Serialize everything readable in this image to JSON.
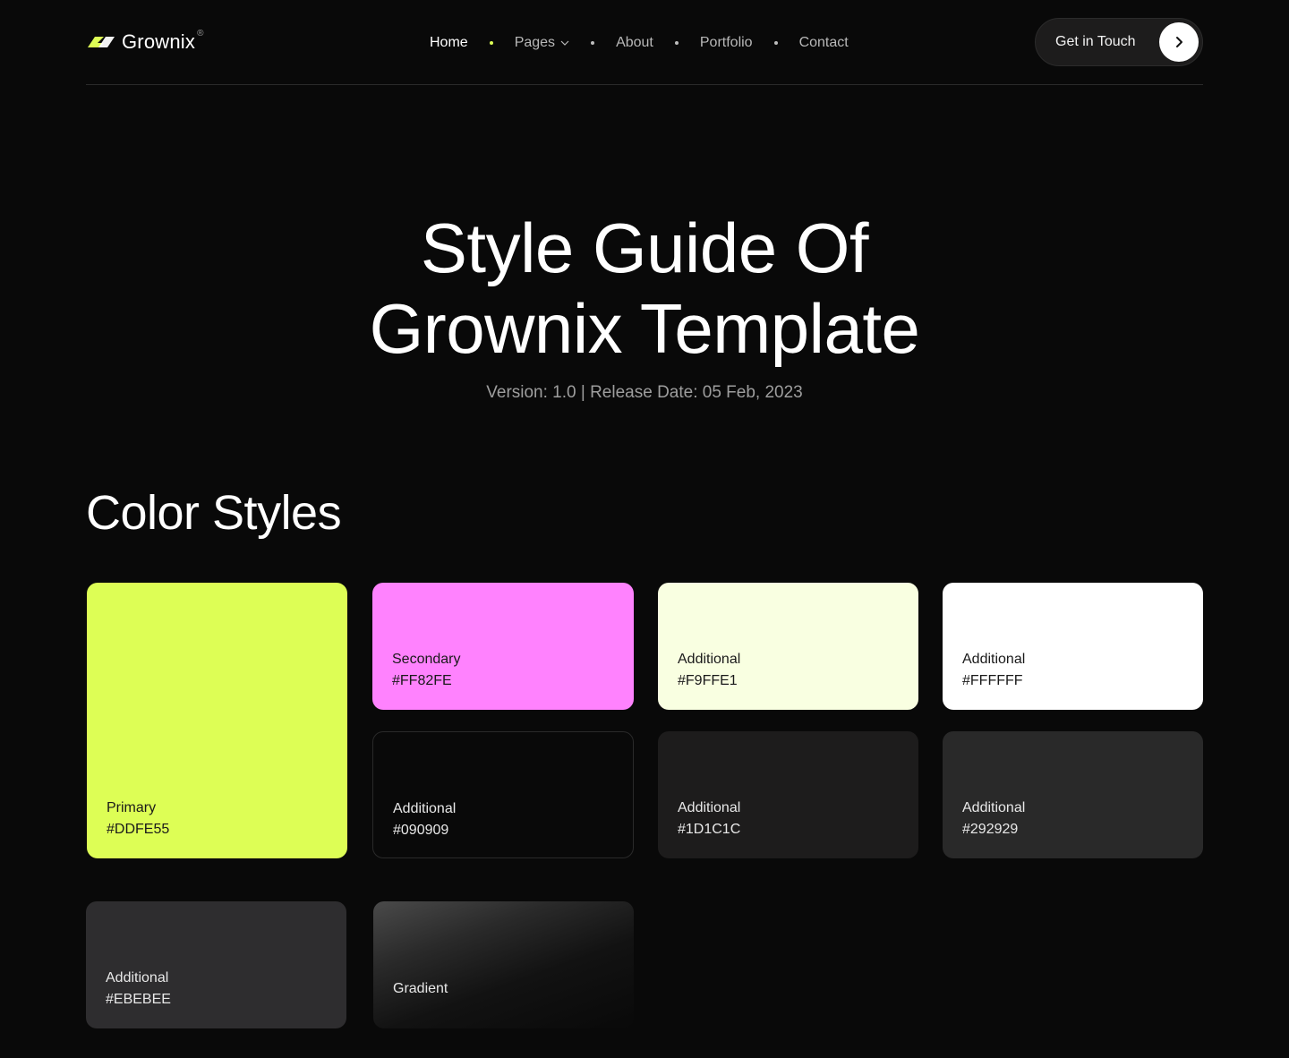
{
  "header": {
    "brand": "Grownix",
    "brand_mark": "®",
    "nav": [
      {
        "label": "Home"
      },
      {
        "label": "Pages"
      },
      {
        "label": "About"
      },
      {
        "label": "Portfolio"
      },
      {
        "label": "Contact"
      }
    ],
    "cta_label": "Get in Touch",
    "accent_color": "#DDFE55"
  },
  "hero": {
    "title_line1": "Style Guide Of",
    "title_line2": "Grownix Template",
    "subtitle": "Version: 1.0 | Release Date: 05 Feb, 2023"
  },
  "colors_section": {
    "title": "Color Styles",
    "swatches": [
      {
        "name": "Primary",
        "hex": "#DDFE55",
        "fill": "#DDFE55"
      },
      {
        "name": "Secondary",
        "hex": "#FF82FE",
        "fill": "#FF82FE"
      },
      {
        "name": "Additional",
        "hex": "#F9FFE1",
        "fill": "#F9FFE1"
      },
      {
        "name": "Additional",
        "hex": "#FFFFFF",
        "fill": "#FFFFFF"
      },
      {
        "name": "Additional",
        "hex": "#090909",
        "fill": "#090909"
      },
      {
        "name": "Additional",
        "hex": "#1D1C1C",
        "fill": "#1D1C1C"
      },
      {
        "name": "Additional",
        "hex": "#292929",
        "fill": "#292929"
      },
      {
        "name": "Additional",
        "hex": "#EBEBEE",
        "fill": "#2E2D2F"
      },
      {
        "name": "Gradient"
      }
    ]
  }
}
